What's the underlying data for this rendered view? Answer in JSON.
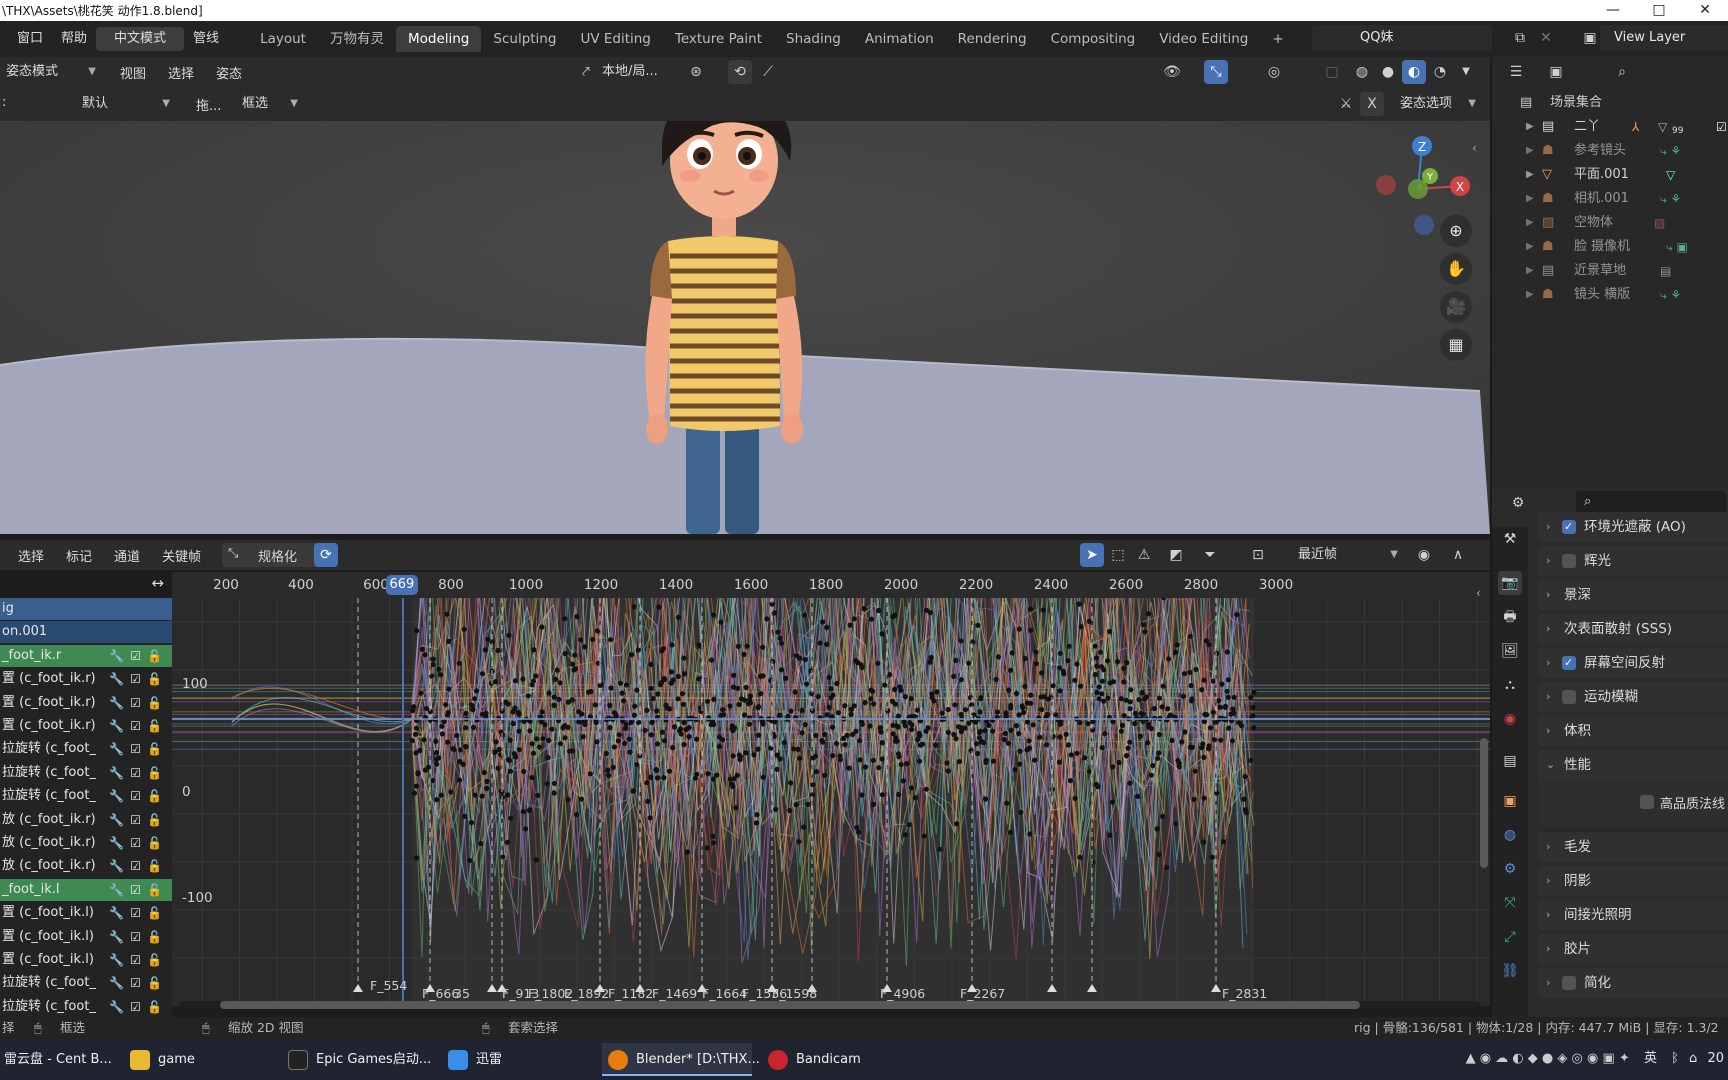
{
  "window": {
    "title": "\\THX\\Assets\\桃花笑 动作1.8.blend]",
    "controls": [
      "—",
      "□",
      "✕"
    ]
  },
  "menubar": {
    "items": [
      "窗口",
      "帮助",
      "中文模式",
      "管线"
    ],
    "active_item": "中文模式",
    "workspaces": [
      "Layout",
      "万物有灵",
      "Modeling",
      "Sculpting",
      "UV Editing",
      "Texture Paint",
      "Shading",
      "Animation",
      "Rendering",
      "Compositing",
      "Video Editing"
    ],
    "active_workspace": "Modeling",
    "add_tab": "+",
    "scene": "QQ妹",
    "view_layer": "View Layer"
  },
  "viewport_header": {
    "mode": "姿态模式",
    "menus": [
      "视图",
      "选择",
      "姿态"
    ],
    "transform_orientation": "本地/局...",
    "overlay_label": "姿态选项"
  },
  "viewport_toolbar": {
    "prefix": ":",
    "pivot": "默认",
    "drag_label": "拖...",
    "select_mode": "框选"
  },
  "gizmo": {
    "axes": [
      "Z",
      "Y",
      "X"
    ],
    "tools": [
      "zoom-icon",
      "hand-icon",
      "camera-icon",
      "grid-icon"
    ]
  },
  "outliner": {
    "root": "场景集合",
    "items": [
      {
        "name": "二丫",
        "icon": "collection-icon",
        "badge": "99"
      },
      {
        "name": "参考镜头",
        "icon": "object-icon",
        "badge": ""
      },
      {
        "name": "平面.001",
        "icon": "mesh-icon",
        "badge": ""
      },
      {
        "name": "相机.001",
        "icon": "object-icon",
        "badge": ""
      },
      {
        "name": "空物体",
        "icon": "image-icon",
        "badge": ""
      },
      {
        "name": "脸 摄像机",
        "icon": "object-icon",
        "badge": ""
      },
      {
        "name": "近景草地",
        "icon": "collection-icon",
        "badge": ""
      },
      {
        "name": "镜头 横版",
        "icon": "object-icon",
        "badge": ""
      }
    ]
  },
  "properties": {
    "panels": [
      {
        "label": "环境光遮蔽 (AO)",
        "checkbox": true,
        "checked": true,
        "expanded": false
      },
      {
        "label": "辉光",
        "checkbox": true,
        "checked": false,
        "expanded": false
      },
      {
        "label": "景深",
        "checkbox": false,
        "checked": false,
        "expanded": false
      },
      {
        "label": "次表面散射 (SSS)",
        "checkbox": false,
        "checked": false,
        "expanded": false
      },
      {
        "label": "屏幕空间反射",
        "checkbox": true,
        "checked": true,
        "expanded": false
      },
      {
        "label": "运动模糊",
        "checkbox": true,
        "checked": false,
        "expanded": false
      },
      {
        "label": "体积",
        "checkbox": false,
        "checked": false,
        "expanded": false
      },
      {
        "label": "性能",
        "checkbox": false,
        "checked": false,
        "expanded": true
      },
      {
        "label": "毛发",
        "checkbox": false,
        "checked": false,
        "expanded": false
      },
      {
        "label": "阴影",
        "checkbox": false,
        "checked": false,
        "expanded": false
      },
      {
        "label": "间接光照明",
        "checkbox": false,
        "checked": false,
        "expanded": false
      },
      {
        "label": "胶片",
        "checkbox": false,
        "checked": false,
        "expanded": false
      },
      {
        "label": "简化",
        "checkbox": true,
        "checked": false,
        "expanded": false
      }
    ],
    "sub_option": "高品质法线"
  },
  "graph_editor": {
    "menus": [
      "选择",
      "标记",
      "通道",
      "关键帧"
    ],
    "normalize": "规格化",
    "snap_mode": "最近帧",
    "current_frame": "669",
    "ruler": [
      "200",
      "400",
      "600",
      "800",
      "1000",
      "1200",
      "1400",
      "1600",
      "1800",
      "2000",
      "2200",
      "2400",
      "2600",
      "2800",
      "3000"
    ],
    "y_ticks": [
      "100",
      "0",
      "-100"
    ],
    "markers": [
      "F_554",
      "F_666",
      "35",
      "F_913",
      "F_1802",
      "F_1892",
      "F_1182",
      "F_1469",
      "F_1664",
      "F_1536",
      "F_1598",
      "F_4906",
      "F_2267",
      "F_2831"
    ]
  },
  "channels": {
    "rows": [
      {
        "label": "ig",
        "type": "rig"
      },
      {
        "label": "on.001",
        "type": "obj"
      },
      {
        "label": "_foot_ik.r",
        "type": "grp"
      },
      {
        "label": "置 (c_foot_ik.r)",
        "type": "ch"
      },
      {
        "label": "置 (c_foot_ik.r)",
        "type": "ch"
      },
      {
        "label": "置 (c_foot_ik.r)",
        "type": "ch"
      },
      {
        "label": "拉旋转 (c_foot_",
        "type": "ch"
      },
      {
        "label": "拉旋转 (c_foot_",
        "type": "ch"
      },
      {
        "label": "拉旋转 (c_foot_",
        "type": "ch"
      },
      {
        "label": "放 (c_foot_ik.r)",
        "type": "ch"
      },
      {
        "label": "放 (c_foot_ik.r)",
        "type": "ch"
      },
      {
        "label": "放 (c_foot_ik.r)",
        "type": "ch"
      },
      {
        "label": "_foot_ik.l",
        "type": "grp"
      },
      {
        "label": "置 (c_foot_ik.l)",
        "type": "ch"
      },
      {
        "label": "置 (c_foot_ik.l)",
        "type": "ch"
      },
      {
        "label": "置 (c_foot_ik.l)",
        "type": "ch"
      },
      {
        "label": "拉旋转 (c_foot_",
        "type": "ch"
      },
      {
        "label": "拉旋转 (c_foot_",
        "type": "ch"
      }
    ]
  },
  "statusbar": {
    "left": "择",
    "box_select": "框选",
    "zoom": "缩放 2D 视图",
    "lasso": "套索选择",
    "stats": "rig | 骨骼:136/581 | 物体:1/28 | 内存: 447.7 MiB | 显存: 1.3/2"
  },
  "taskbar": {
    "items": [
      {
        "label": "雷云盘 - Cent B...",
        "color": "#3a7bd5"
      },
      {
        "label": "game",
        "color": "#e8b931"
      },
      {
        "label": "Epic Games启动...",
        "color": "#222222"
      },
      {
        "label": "迅雷",
        "color": "#3a8ee6"
      },
      {
        "label": "Blender* [D:\\THX...",
        "color": "#e87d0d"
      },
      {
        "label": "Bandicam",
        "color": "#c8262c"
      }
    ],
    "active": "Blender* [D:\\THX...",
    "tray": "英",
    "clock": "20"
  }
}
